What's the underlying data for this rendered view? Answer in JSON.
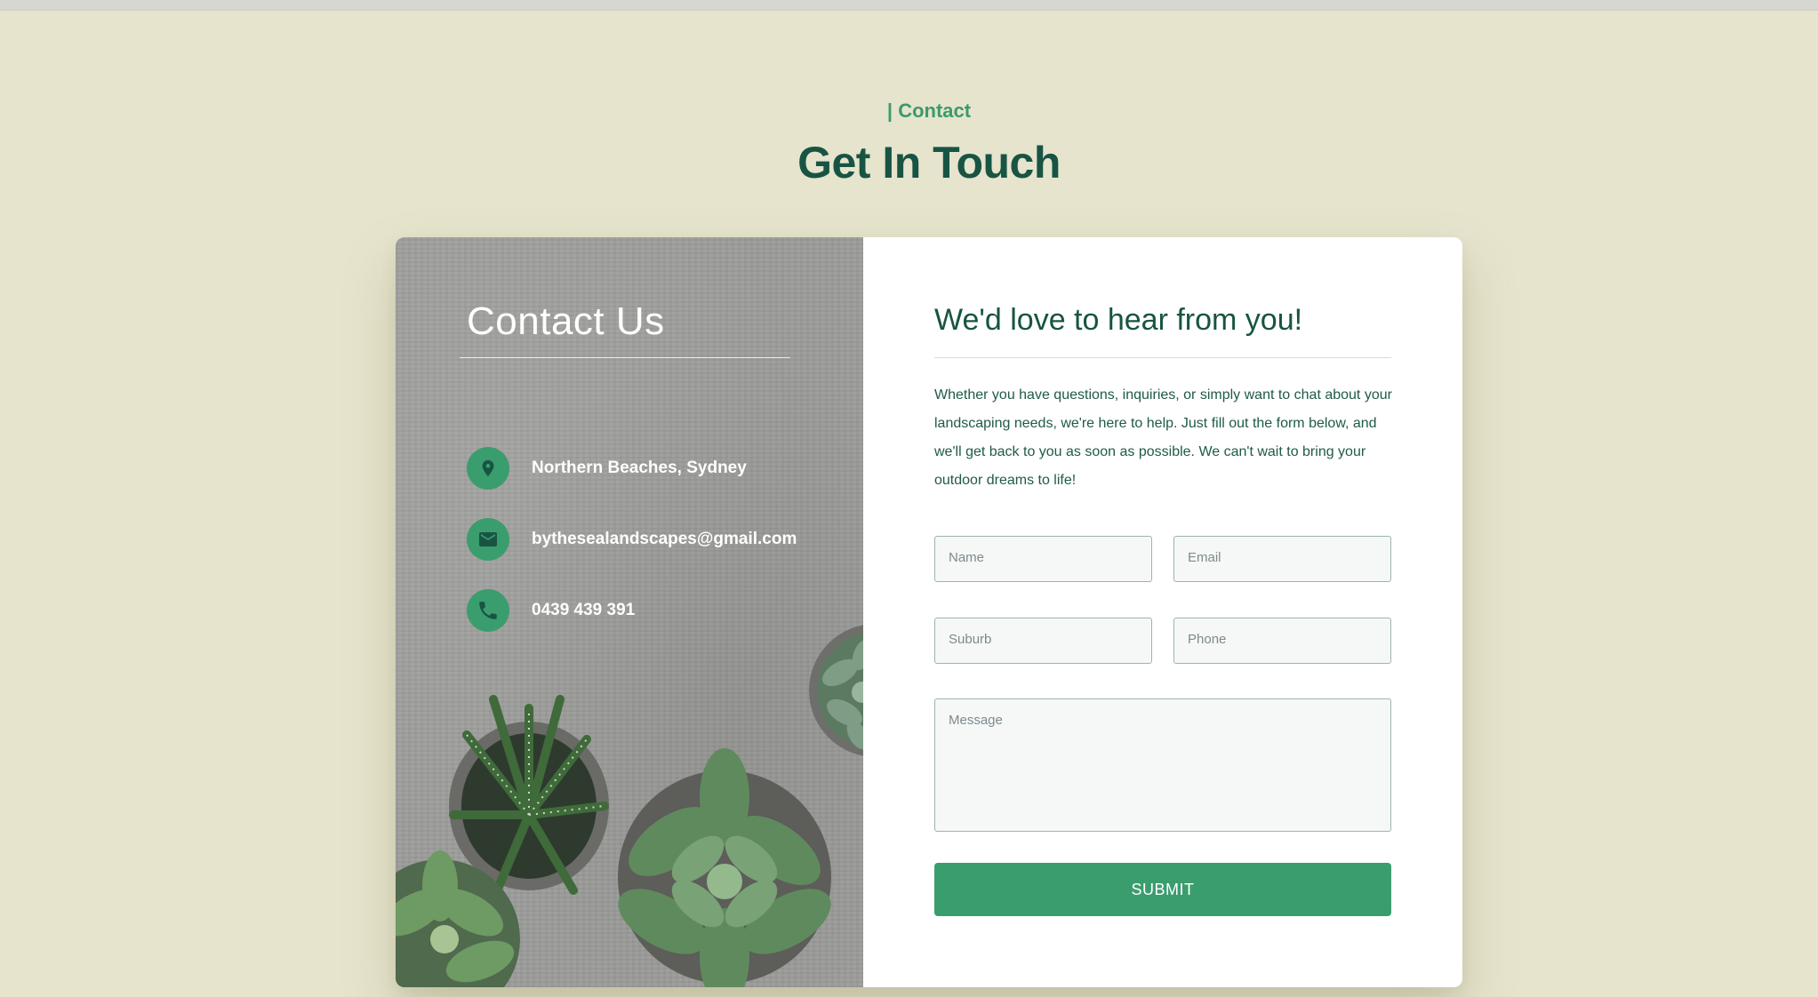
{
  "section": {
    "eyebrow": "| Contact",
    "title": "Get In Touch"
  },
  "contact_panel": {
    "title": "Contact Us",
    "items": [
      {
        "icon": "location-pin-icon",
        "text": "Northern Beaches, Sydney"
      },
      {
        "icon": "mail-icon",
        "text": "bythesealandscapes@gmail.com"
      },
      {
        "icon": "phone-icon",
        "text": "0439 439 391"
      }
    ]
  },
  "form": {
    "title": "We'd love to hear from you!",
    "intro": "Whether you have questions, inquiries, or simply want to chat about your landscaping needs, we're here to help. Just fill out the form below, and we'll get back to you as soon as possible. We can't wait to bring your outdoor dreams to life!",
    "fields": {
      "name_placeholder": "Name",
      "email_placeholder": "Email",
      "suburb_placeholder": "Suburb",
      "phone_placeholder": "Phone",
      "message_placeholder": "Message"
    },
    "submit_label": "SUBMIT"
  },
  "colors": {
    "page_bg": "#e6e4cd",
    "accent_green": "#3a9d6e",
    "dark_green": "#185443"
  }
}
